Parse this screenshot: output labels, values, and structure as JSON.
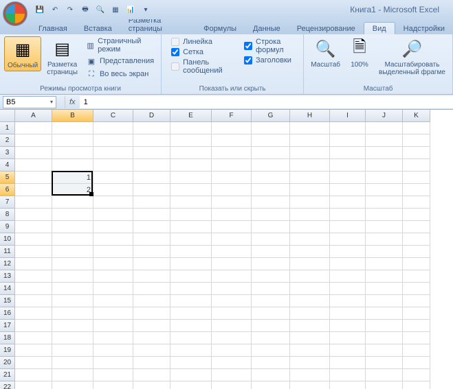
{
  "title": "Книга1 - Microsoft Excel",
  "tabs": [
    {
      "label": "Главная"
    },
    {
      "label": "Вставка"
    },
    {
      "label": "Разметка страницы"
    },
    {
      "label": "Формулы"
    },
    {
      "label": "Данные"
    },
    {
      "label": "Рецензирование"
    },
    {
      "label": "Вид",
      "active": true
    },
    {
      "label": "Надстройки"
    }
  ],
  "ribbon": {
    "views": {
      "normal": "Обычный",
      "page_layout": "Разметка\nстраницы",
      "page_break": "Страничный режим",
      "custom_views": "Представления",
      "full_screen": "Во весь экран",
      "group_label": "Режимы просмотра книги"
    },
    "show": {
      "ruler": "Линейка",
      "grid": "Сетка",
      "messages": "Панель сообщений",
      "formula_bar": "Строка формул",
      "headings": "Заголовки",
      "group_label": "Показать или скрыть"
    },
    "zoom": {
      "zoom": "Масштаб",
      "hundred": "100%",
      "fit": "Масштабировать\nвыделенный фрагме",
      "group_label": "Масштаб"
    }
  },
  "name_box": "B5",
  "formula_value": "1",
  "columns": [
    "A",
    "B",
    "C",
    "D",
    "E",
    "F",
    "G",
    "H",
    "I",
    "J",
    "K"
  ],
  "row_count": 22,
  "cells": {
    "B5": "1",
    "B6": "2"
  },
  "selection": {
    "col": "B",
    "top_row": 5,
    "bottom_row": 6
  }
}
